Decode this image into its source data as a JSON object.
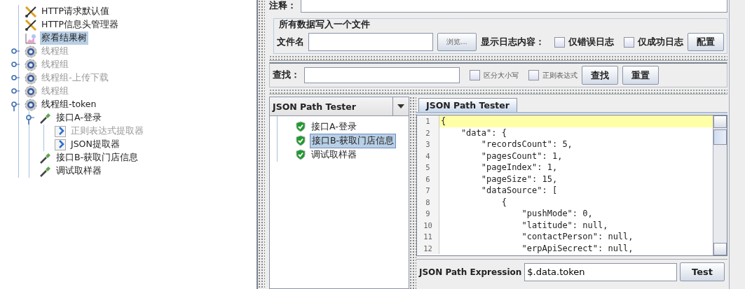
{
  "tree": [
    {
      "label": "HTTP请求默认值",
      "kind": "config",
      "disabled": false,
      "selected": false
    },
    {
      "label": "HTTP信息头管理器",
      "kind": "config",
      "disabled": false,
      "selected": false
    },
    {
      "label": "察看结果树",
      "kind": "listener",
      "disabled": false,
      "selected": true
    },
    {
      "label": "线程组",
      "kind": "threadgroup",
      "disabled": true,
      "selected": false,
      "expanded": false
    },
    {
      "label": "线程组",
      "kind": "threadgroup",
      "disabled": true,
      "selected": false,
      "expanded": false
    },
    {
      "label": "线程组-上传下载",
      "kind": "threadgroup",
      "disabled": true,
      "selected": false,
      "expanded": false
    },
    {
      "label": "线程组",
      "kind": "threadgroup",
      "disabled": true,
      "selected": false,
      "expanded": false
    },
    {
      "label": "线程组-token",
      "kind": "threadgroup",
      "disabled": false,
      "selected": false,
      "expanded": true,
      "children": [
        {
          "label": "接口A-登录",
          "kind": "sampler",
          "disabled": false,
          "selected": false,
          "expanded": true,
          "children": [
            {
              "label": "正则表达式提取器",
              "kind": "extractor",
              "disabled": true,
              "selected": false
            },
            {
              "label": "JSON提取器",
              "kind": "extractor",
              "disabled": false,
              "selected": false
            }
          ]
        },
        {
          "label": "接口B-获取门店信息",
          "kind": "sampler",
          "disabled": false,
          "selected": false
        },
        {
          "label": "调试取样器",
          "kind": "sampler",
          "disabled": false,
          "selected": false
        }
      ]
    }
  ],
  "comment": {
    "label": "注释："
  },
  "file_group": {
    "title": "所有数据写入一个文件",
    "filename_label": "文件名",
    "browse_button": "浏览...",
    "log_label": "显示日志内容：",
    "config_button": "配置",
    "checkboxes": [
      {
        "label": "仅错误日志",
        "checked": false
      },
      {
        "label": "仅成功日志",
        "checked": false
      }
    ]
  },
  "search": {
    "label": "查找：",
    "checkboxes": [
      {
        "label": "区分大小写",
        "checked": false
      },
      {
        "label": "正则表达式",
        "checked": false
      }
    ],
    "buttons": [
      "查找",
      "重置"
    ]
  },
  "renderer": {
    "value": "JSON Path Tester"
  },
  "results": [
    {
      "label": "接口A-登录",
      "selected": false
    },
    {
      "label": "接口B-获取门店信息",
      "selected": true
    },
    {
      "label": "调试取样器",
      "selected": false
    }
  ],
  "tab": {
    "label": "JSON Path Tester",
    "selected": true
  },
  "code_lines": [
    {
      "number": "1",
      "text": "{",
      "highlighted": true
    },
    {
      "number": "2",
      "text": "    \"data\": {",
      "highlighted": false
    },
    {
      "number": "3",
      "text": "        \"recordsCount\": 5,",
      "highlighted": false
    },
    {
      "number": "4",
      "text": "        \"pagesCount\": 1,",
      "highlighted": false
    },
    {
      "number": "5",
      "text": "        \"pageIndex\": 1,",
      "highlighted": false
    },
    {
      "number": "6",
      "text": "        \"pageSize\": 15,",
      "highlighted": false
    },
    {
      "number": "7",
      "text": "        \"dataSource\": [",
      "highlighted": false
    },
    {
      "number": "8",
      "text": "            {",
      "highlighted": false
    },
    {
      "number": "9",
      "text": "                \"pushMode\": 0,",
      "highlighted": false
    },
    {
      "number": "10",
      "text": "                \"latitude\": null,",
      "highlighted": false
    },
    {
      "number": "11",
      "text": "                \"contactPerson\": null,",
      "highlighted": false
    },
    {
      "number": "12",
      "text": "                \"erpApiSecrect\": null,",
      "highlighted": false
    }
  ],
  "expression": {
    "label": "JSON Path Expression",
    "value": "$.data.token",
    "button": "Test"
  }
}
